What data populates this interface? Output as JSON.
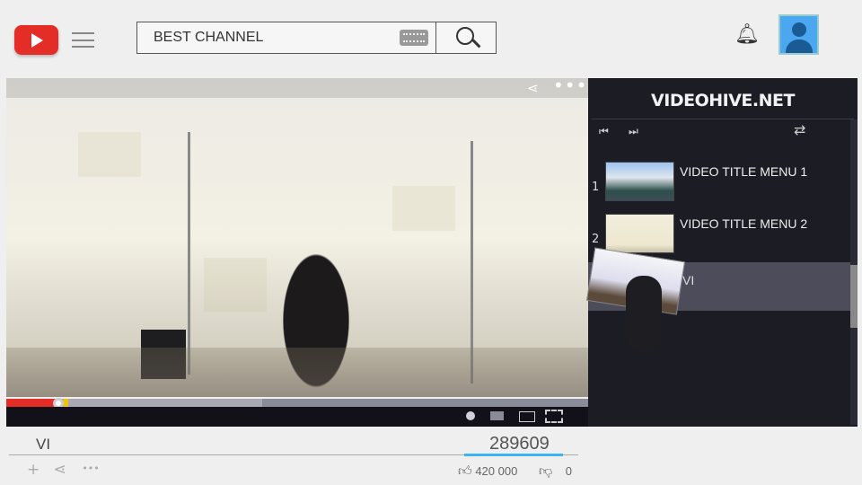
{
  "header": {
    "search_value": "BEST CHANNEL",
    "logo_icon": "youtube-play-icon",
    "menu_icon": "hamburger-icon",
    "search_icon": "magnifier-icon",
    "keyboard_icon": "keyboard-icon",
    "bell_icon": "bell-icon",
    "avatar_icon": "user-avatar-icon"
  },
  "player": {
    "progress_played": 0.09,
    "progress_buffered": 0.44
  },
  "sidebar": {
    "title": "VIDEOHIVE.NET",
    "prev_icon": "⏮",
    "next_icon": "⏭",
    "repeat_icon": "⇄",
    "items": [
      {
        "number": "1",
        "title": "VIDEO TITLE MENU 1"
      },
      {
        "number": "2",
        "title": "VIDEO TITLE MENU 2"
      }
    ],
    "active_title": "VI"
  },
  "info": {
    "title": "VI",
    "views": "289609",
    "likes": "420 000",
    "dislikes": "0",
    "add_icon": "+",
    "share_icon": "⋖",
    "more_icon": "•••"
  },
  "colors": {
    "accent": "#e52d27",
    "views_underline": "#3ab4f2",
    "avatar": "#4aa7f0"
  }
}
